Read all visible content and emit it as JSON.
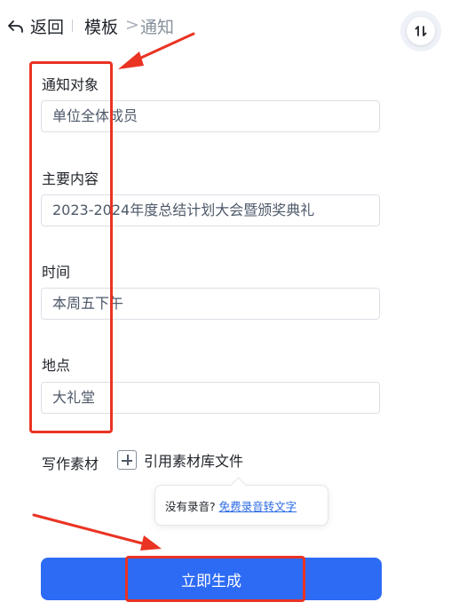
{
  "header": {
    "back_label": "返回",
    "breadcrumb_parent": "模板",
    "breadcrumb_separator": ">",
    "breadcrumb_current": "通知",
    "swap_icon": "sort-swap-icon"
  },
  "form": {
    "fields": [
      {
        "label": "通知对象",
        "value": "单位全体成员"
      },
      {
        "label": "主要内容",
        "value": "2023-2024年度总结计划大会暨颁奖典礼"
      },
      {
        "label": "时间",
        "value": "本周五下午"
      },
      {
        "label": "地点",
        "value": "大礼堂"
      }
    ],
    "material_label": "写作素材",
    "reference_label": "引用素材库文件"
  },
  "tooltip": {
    "text": "没有录音?",
    "link": "免费录音转文字"
  },
  "generate_button": "立即生成",
  "colors": {
    "primary": "#2d6bf5",
    "annotation_red": "#ea3323",
    "link": "#2b6ae6"
  }
}
